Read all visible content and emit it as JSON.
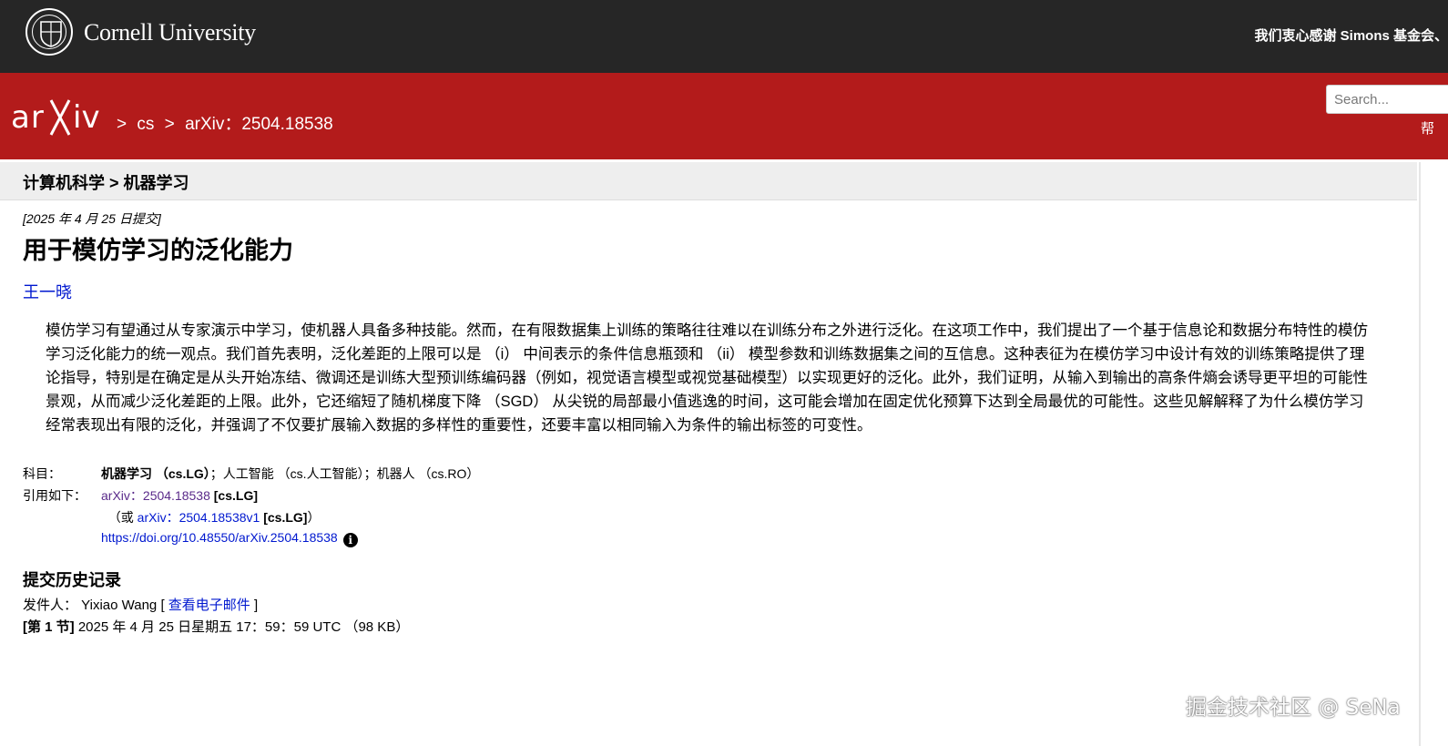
{
  "cornell": {
    "name": "Cornell University",
    "thanks": "我们衷心感谢 Simons 基金会、"
  },
  "arxiv": {
    "logo_text": "arXiv",
    "breadcrumb": [
      ">",
      "cs",
      ">",
      "arXiv：2504.18538"
    ],
    "search_placeholder": "Search...",
    "help_partial": "帮"
  },
  "subheader": {
    "trail": "计算机科学 > 机器学习"
  },
  "paper": {
    "dateline": "[2025 年 4 月 25 日提交]",
    "title": "用于模仿学习的泛化能力",
    "author": "王一晓",
    "abstract": "模仿学习有望通过从专家演示中学习，使机器人具备多种技能。然而，在有限数据集上训练的策略往往难以在训练分布之外进行泛化。在这项工作中，我们提出了一个基于信息论和数据分布特性的模仿学习泛化能力的统一观点。我们首先表明，泛化差距的上限可以是 （i） 中间表示的条件信息瓶颈和 （ii） 模型参数和训练数据集之间的互信息。这种表征为在模仿学习中设计有效的训练策略提供了理论指导，特别是在确定是从头开始冻结、微调还是训练大型预训练编码器（例如，视觉语言模型或视觉基础模型）以实现更好的泛化。此外，我们证明，从输入到输出的高条件熵会诱导更平坦的可能性景观，从而减少泛化差距的上限。此外，它还缩短了随机梯度下降 （SGD） 从尖锐的局部最小值逃逸的时间，这可能会增加在固定优化预算下达到全局最优的可能性。这些见解解释了为什么模仿学习经常表现出有限的泛化，并强调了不仅要扩展输入数据的多样性的重要性，还要丰富以相同输入为条件的输出标签的可变性。"
  },
  "meta": {
    "subjects_label": "科目：",
    "subject_primary": "机器学习 （cs.LG）",
    "subject_rest": "；人工智能 （cs.人工智能）；机器人 （cs.RO）",
    "cite_label": "引用如下：",
    "cite_arxiv": "arXiv：",
    "cite_id": "2504.18538",
    "cite_tag": "[cs.LG]",
    "cite_alt_prefix": "（或 ",
    "cite_alt_link": "arXiv：2504.18538v1",
    "cite_alt_tag": "[cs.LG]",
    "cite_alt_suffix": "）",
    "doi": "https://doi.org/10.48550/arXiv.2504.18538",
    "info_icon": "i"
  },
  "history": {
    "heading": "提交历史记录",
    "from_label": "发件人：",
    "from_name": " Yixiao Wang [ ",
    "email_link": "查看电子邮件",
    "from_close": " ]",
    "version_label": "[第 1 节]",
    "version_text": " 2025 年 4 月 25 日星期五 17：59：59 UTC （98 KB）"
  },
  "watermark": "掘金技术社区 @ SeNa"
}
